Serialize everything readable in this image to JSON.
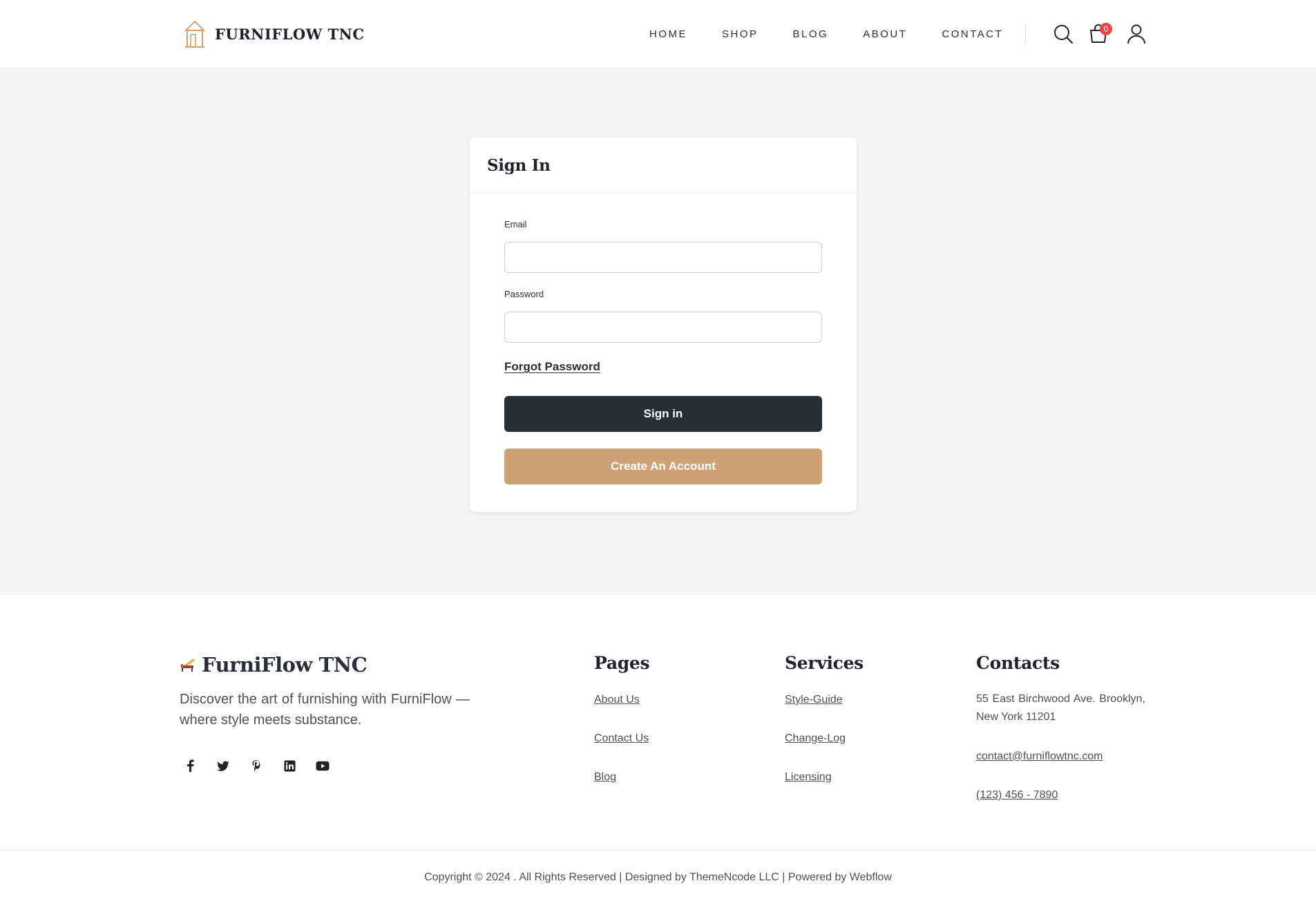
{
  "header": {
    "brand": "FURNIFLOW TNC",
    "nav": [
      "HOME",
      "SHOP",
      "BLOG",
      "ABOUT",
      "CONTACT"
    ],
    "cart_count": "0",
    "icons": [
      "search-icon",
      "cart-icon",
      "user-icon"
    ]
  },
  "signin": {
    "title": "Sign In",
    "email_label": "Email",
    "email_value": "",
    "password_label": "Password",
    "password_value": "",
    "forgot_label": "Forgot Password",
    "signin_label": "Sign in",
    "create_label": "Create An Account"
  },
  "footer": {
    "brand": "FurniFlow TNC",
    "description": "Discover the art of furnishing with FurniFlow — where style meets substance.",
    "social_icons": [
      "facebook-icon",
      "twitter-icon",
      "pinterest-icon",
      "linkedin-icon",
      "youtube-icon"
    ],
    "pages": {
      "title": "Pages",
      "items": [
        "About Us",
        "Contact Us",
        "Blog"
      ]
    },
    "services": {
      "title": "Services",
      "items": [
        "Style-Guide",
        "Change-Log",
        "Licensing"
      ]
    },
    "contacts": {
      "title": "Contacts",
      "address": "55 East Birchwood Ave. Brooklyn, New York 11201",
      "email": "contact@furniflowtnc.com",
      "phone": "(123) 456 - 7890"
    },
    "copyright": "Copyright © 2024 . All Rights Reserved |  Designed by ThemeNcode LLC | Powered by Webflow"
  },
  "colors": {
    "accent": "#cda274",
    "dark": "#2a2e38",
    "badge": "#ef4444",
    "background": "#f4f4f4"
  }
}
